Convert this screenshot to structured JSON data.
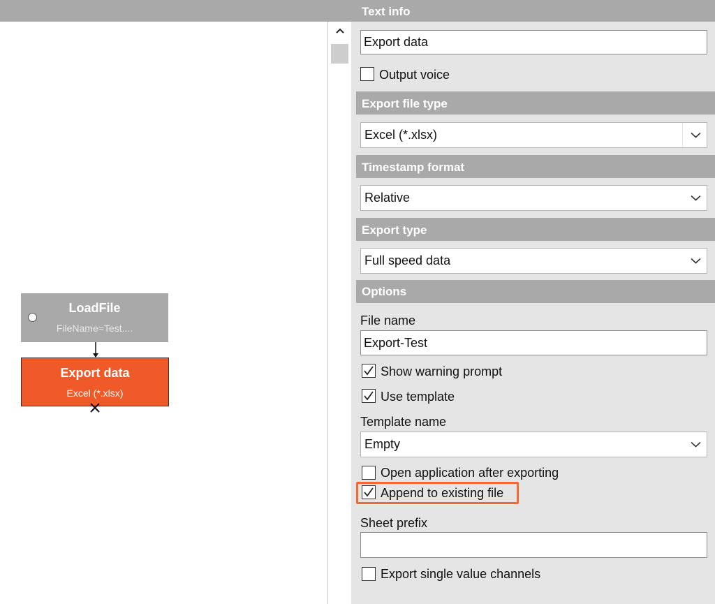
{
  "panel": {
    "text_info": {
      "header": "Text info",
      "value": "Export data"
    },
    "output_voice": {
      "label": "Output voice",
      "checked": false
    },
    "export_file_type": {
      "header": "Export file type",
      "value": "Excel (*.xlsx)"
    },
    "timestamp_format": {
      "header": "Timestamp format",
      "value": "Relative"
    },
    "export_type": {
      "header": "Export type",
      "value": "Full speed data"
    },
    "options": {
      "header": "Options",
      "file_name_label": "File name",
      "file_name_value": "Export-Test",
      "show_warning_prompt": {
        "label": "Show warning prompt",
        "checked": true
      },
      "use_template": {
        "label": "Use template",
        "checked": true
      },
      "template_name_label": "Template name",
      "template_name_value": "Empty",
      "open_application": {
        "label": "Open application after exporting",
        "checked": false
      },
      "append_existing": {
        "label": "Append to existing file",
        "checked": true
      },
      "sheet_prefix_label": "Sheet prefix",
      "sheet_prefix_value": "",
      "export_single_value": {
        "label": "Export single value channels",
        "checked": false
      }
    }
  },
  "canvas": {
    "load_node": {
      "title": "LoadFile",
      "subtitle": "FileName=Test...."
    },
    "export_node": {
      "title": "Export data",
      "subtitle": "Excel (*.xlsx)"
    }
  },
  "colors": {
    "accent": "#f05a28",
    "header": "#a9a9a9",
    "highlight": "#f26a30"
  }
}
